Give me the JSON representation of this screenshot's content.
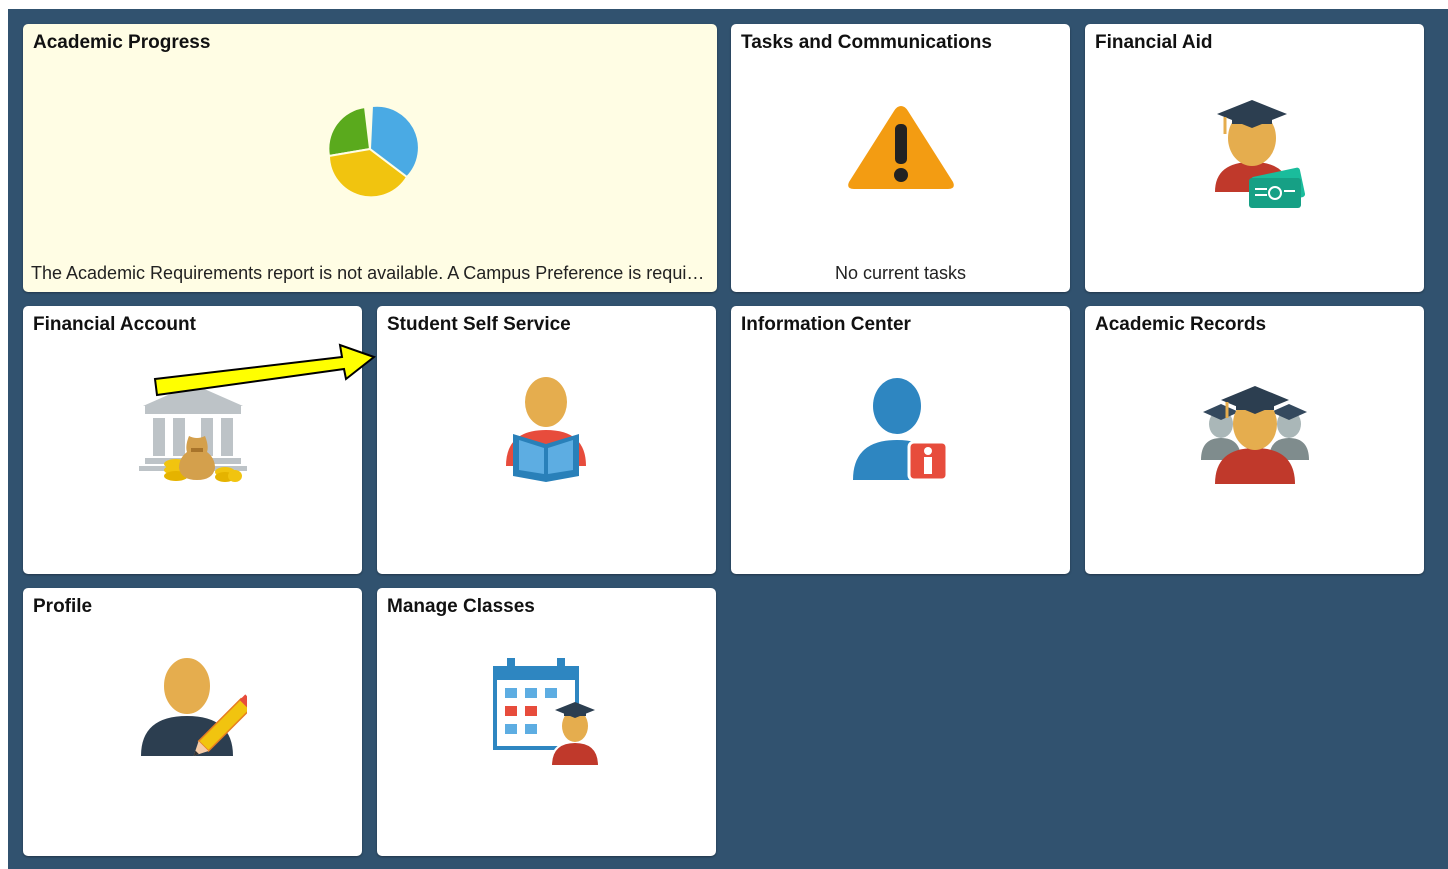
{
  "tiles": [
    {
      "id": "academic_progress",
      "title": "Academic Progress",
      "icon": "pie-chart-icon",
      "footer": "The Academic Requirements report is not available.  A Campus Preference is required."
    },
    {
      "id": "tasks",
      "title": "Tasks and Communications",
      "icon": "warning-icon",
      "footer": "No current tasks"
    },
    {
      "id": "financial_aid",
      "title": "Financial Aid",
      "icon": "graduate-money-icon"
    },
    {
      "id": "financial_account",
      "title": "Financial Account",
      "icon": "bank-icon"
    },
    {
      "id": "student_self_service",
      "title": "Student Self Service",
      "icon": "student-reading-icon"
    },
    {
      "id": "information_center",
      "title": "Information Center",
      "icon": "person-info-icon"
    },
    {
      "id": "academic_records",
      "title": "Academic Records",
      "icon": "graduates-group-icon"
    },
    {
      "id": "profile",
      "title": "Profile",
      "icon": "person-edit-icon"
    },
    {
      "id": "manage_classes",
      "title": "Manage Classes",
      "icon": "calendar-graduate-icon"
    }
  ],
  "colors": {
    "background": "#31526f",
    "tile": "#ffffff",
    "highlight_tile": "#fffde4",
    "annotation_arrow": "#ffff00"
  },
  "annotation": {
    "type": "arrow",
    "points_to": "student_self_service"
  }
}
